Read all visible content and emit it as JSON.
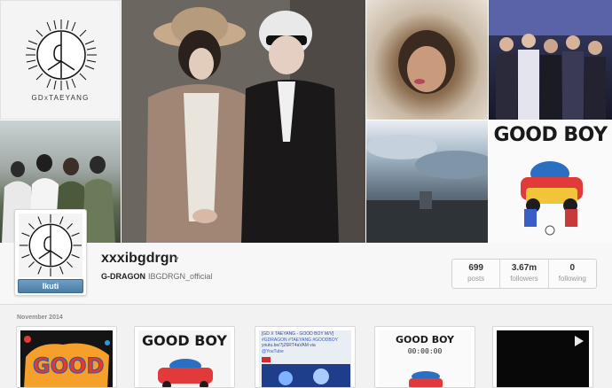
{
  "banner": {
    "logo_caption_left": "GD",
    "logo_caption_x": "X",
    "logo_caption_right": "TAEYANG",
    "album_title": "GOOD BOY"
  },
  "profile": {
    "username": "xxxibgdrgn",
    "caret": "▼",
    "full_name": "G-DRAGON",
    "website": "IBGDRGN_official",
    "follow_label": "Ikuti",
    "stats": [
      {
        "value": "699",
        "label": "posts"
      },
      {
        "value": "3.67m",
        "label": "followers"
      },
      {
        "value": "0",
        "label": "following"
      }
    ]
  },
  "feed": {
    "month": "November 2014",
    "thumbs": [
      {
        "kind": "artwork"
      },
      {
        "kind": "album",
        "title": "GOOD BOY"
      },
      {
        "kind": "youtube",
        "lines": [
          "[GD X TAEYANG - GOOD BOY M/V]",
          "#GDRAGON #TAEYANG #GOODBOY",
          "youtu.be/7jZ6RT4aVAM via",
          "@YouTube"
        ]
      },
      {
        "kind": "countdown",
        "title": "GOOD BOY",
        "timer": "00:00:00"
      },
      {
        "kind": "video"
      }
    ]
  },
  "colors": {
    "follow_button": "#4a7ca5",
    "background": "#f2f2f2",
    "stats_text": "#333333"
  }
}
